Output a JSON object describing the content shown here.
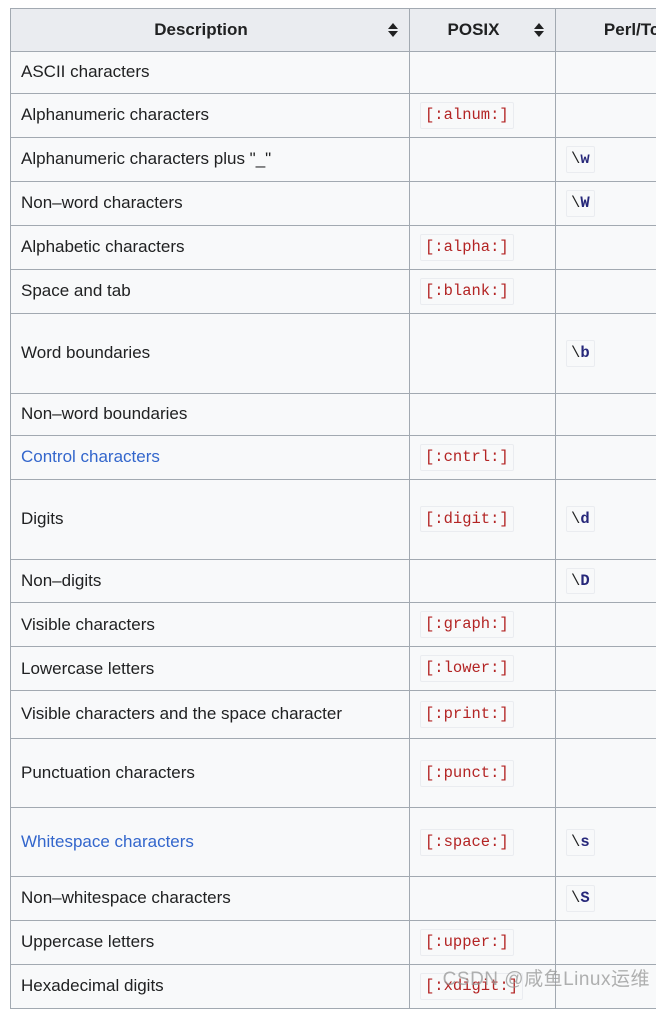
{
  "table": {
    "columns": [
      {
        "label": "Description",
        "sortable": true,
        "sort_icon": "sort-both-icon"
      },
      {
        "label": "POSIX",
        "sortable": true,
        "sort_icon": "sort-both-icon"
      },
      {
        "label": "Perl/Tcl",
        "sortable": true,
        "sort_icon": "sort-both-icon"
      }
    ],
    "rows": [
      {
        "description": "ASCII characters",
        "is_link": false,
        "posix": "",
        "perl": "",
        "perl_escape": "",
        "perl_letter": "",
        "size": "sm"
      },
      {
        "description": "Alphanumeric characters",
        "is_link": false,
        "posix": "[:alnum:]",
        "perl": "",
        "perl_escape": "",
        "perl_letter": "",
        "size": "sm"
      },
      {
        "description": "Alphanumeric characters plus \"_\"",
        "is_link": false,
        "posix": "",
        "perl": "\\w",
        "perl_escape": "\\",
        "perl_letter": "w",
        "size": "sm"
      },
      {
        "description": "Non–word characters",
        "is_link": false,
        "posix": "",
        "perl": "\\W",
        "perl_escape": "\\",
        "perl_letter": "W",
        "size": "sm"
      },
      {
        "description": "Alphabetic characters",
        "is_link": false,
        "posix": "[:alpha:]",
        "perl": "",
        "perl_escape": "",
        "perl_letter": "",
        "size": "sm"
      },
      {
        "description": "Space and tab",
        "is_link": false,
        "posix": "[:blank:]",
        "perl": "",
        "perl_escape": "",
        "perl_letter": "",
        "size": "sm"
      },
      {
        "description": "Word boundaries",
        "is_link": false,
        "posix": "",
        "perl": "\\b",
        "perl_escape": "\\",
        "perl_letter": "b",
        "size": "lg"
      },
      {
        "description": "Non–word boundaries",
        "is_link": false,
        "posix": "",
        "perl": "",
        "perl_escape": "",
        "perl_letter": "",
        "size": "sm"
      },
      {
        "description": "Control characters",
        "is_link": true,
        "posix": "[:cntrl:]",
        "perl": "",
        "perl_escape": "",
        "perl_letter": "",
        "size": "sm"
      },
      {
        "description": "Digits",
        "is_link": false,
        "posix": "[:digit:]",
        "perl": "\\d",
        "perl_escape": "\\",
        "perl_letter": "d",
        "size": "lg"
      },
      {
        "description": "Non–digits",
        "is_link": false,
        "posix": "",
        "perl": "\\D",
        "perl_escape": "\\",
        "perl_letter": "D",
        "size": "sm"
      },
      {
        "description": "Visible characters",
        "is_link": false,
        "posix": "[:graph:]",
        "perl": "",
        "perl_escape": "",
        "perl_letter": "",
        "size": "sm"
      },
      {
        "description": "Lowercase letters",
        "is_link": false,
        "posix": "[:lower:]",
        "perl": "",
        "perl_escape": "",
        "perl_letter": "",
        "size": "sm"
      },
      {
        "description": "Visible characters and the space character",
        "is_link": false,
        "posix": "[:print:]",
        "perl": "",
        "perl_escape": "",
        "perl_letter": "",
        "size": "md"
      },
      {
        "description": "Punctuation characters",
        "is_link": false,
        "posix": "[:punct:]",
        "perl": "",
        "perl_escape": "",
        "perl_letter": "",
        "size": "xl"
      },
      {
        "description": "Whitespace characters",
        "is_link": true,
        "posix": "[:space:]",
        "perl": "\\s",
        "perl_escape": "\\",
        "perl_letter": "s",
        "size": "xl"
      },
      {
        "description": "Non–whitespace characters",
        "is_link": false,
        "posix": "",
        "perl": "\\S",
        "perl_escape": "\\",
        "perl_letter": "S",
        "size": "sm"
      },
      {
        "description": "Uppercase letters",
        "is_link": false,
        "posix": "[:upper:]",
        "perl": "",
        "perl_escape": "",
        "perl_letter": "",
        "size": "sm"
      },
      {
        "description": "Hexadecimal digits",
        "is_link": false,
        "posix": "[:xdigit:]",
        "perl": "",
        "perl_escape": "",
        "perl_letter": "",
        "size": "sm"
      }
    ]
  },
  "watermark": {
    "text": "CSDN @咸鱼Linux运维"
  },
  "colors": {
    "header_bg": "#eaecf0",
    "cell_bg": "#f8f9fa",
    "border": "#a2a9b1",
    "text": "#202122",
    "link": "#3366cc",
    "posix_code": "#b32424",
    "perl_code": "#26277a"
  }
}
